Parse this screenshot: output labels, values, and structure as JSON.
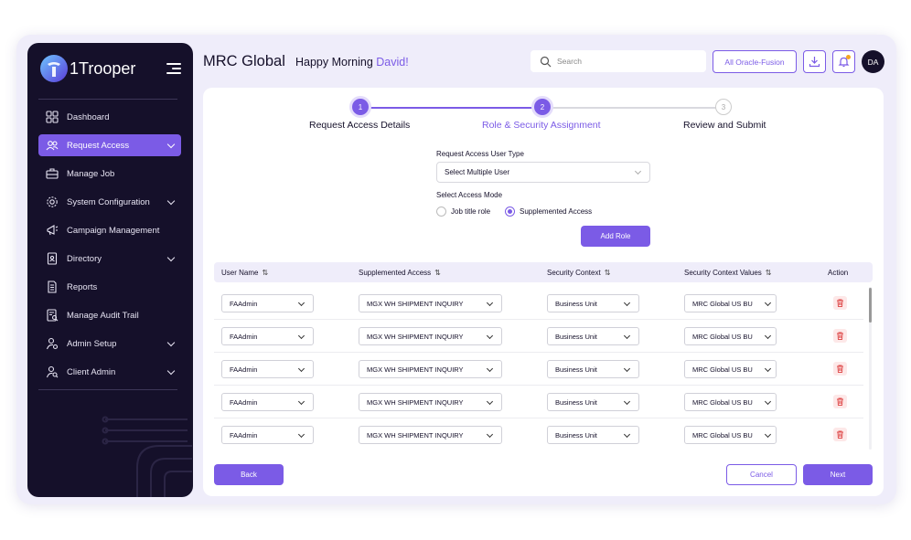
{
  "sidebar": {
    "brand": "1Trooper",
    "items": [
      {
        "label": "Dashboard",
        "icon": "grid-icon"
      },
      {
        "label": "Request Access",
        "icon": "users-icon",
        "active": true
      },
      {
        "label": "Manage Job",
        "icon": "briefcase-icon"
      },
      {
        "label": "System Configuration",
        "icon": "gear-icon"
      },
      {
        "label": "Campaign Management",
        "icon": "megaphone-icon"
      },
      {
        "label": "Directory",
        "icon": "id-badge-icon"
      },
      {
        "label": "Reports",
        "icon": "document-icon"
      },
      {
        "label": "Manage Audit Trail",
        "icon": "audit-icon"
      },
      {
        "label": "Admin Setup",
        "icon": "user-gear-icon"
      },
      {
        "label": "Client Admin",
        "icon": "user-search-icon"
      }
    ]
  },
  "header": {
    "company": "MRC Global",
    "greeting": "Happy Morning",
    "user_name": "David!",
    "search_placeholder": "Search",
    "env_label": "All Oracle-Fusion",
    "avatar": "DA"
  },
  "stepper": {
    "steps": [
      {
        "num": "1",
        "label": "Request Access Details",
        "state": "done"
      },
      {
        "num": "2",
        "label": "Role & Security Assignment",
        "state": "current"
      },
      {
        "num": "3",
        "label": "Review and Submit",
        "state": "todo"
      }
    ]
  },
  "form": {
    "user_type_label": "Request Access User Type",
    "user_type_value": "Select Multiple User",
    "access_mode_label": "Select Access Mode",
    "mode_options": [
      {
        "label": "Job title role",
        "selected": false
      },
      {
        "label": "Supplemented Access",
        "selected": true
      }
    ],
    "add_role": "Add Role"
  },
  "table": {
    "headers": [
      "User Name",
      "Supplemented Access",
      "Security Context",
      "Security Context Values",
      "Action"
    ],
    "rows": [
      [
        "FAAdmin",
        "MGX WH SHIPMENT INQUIRY",
        "Business Unit",
        "MRC Global US BU"
      ],
      [
        "FAAdmin",
        "MGX WH SHIPMENT INQUIRY",
        "Business Unit",
        "MRC Global US BU"
      ],
      [
        "FAAdmin",
        "MGX WH SHIPMENT INQUIRY",
        "Business Unit",
        "MRC Global US BU"
      ],
      [
        "FAAdmin",
        "MGX WH SHIPMENT INQUIRY",
        "Business Unit",
        "MRC Global US BU"
      ],
      [
        "FAAdmin",
        "MGX WH SHIPMENT INQUIRY",
        "Business Unit",
        "MRC Global US BU"
      ]
    ]
  },
  "footer": {
    "back": "Back",
    "cancel": "Cancel",
    "next": "Next"
  },
  "colors": {
    "accent": "#7b5be6",
    "sidebar_bg": "#15102a",
    "delete": "#e05252"
  }
}
